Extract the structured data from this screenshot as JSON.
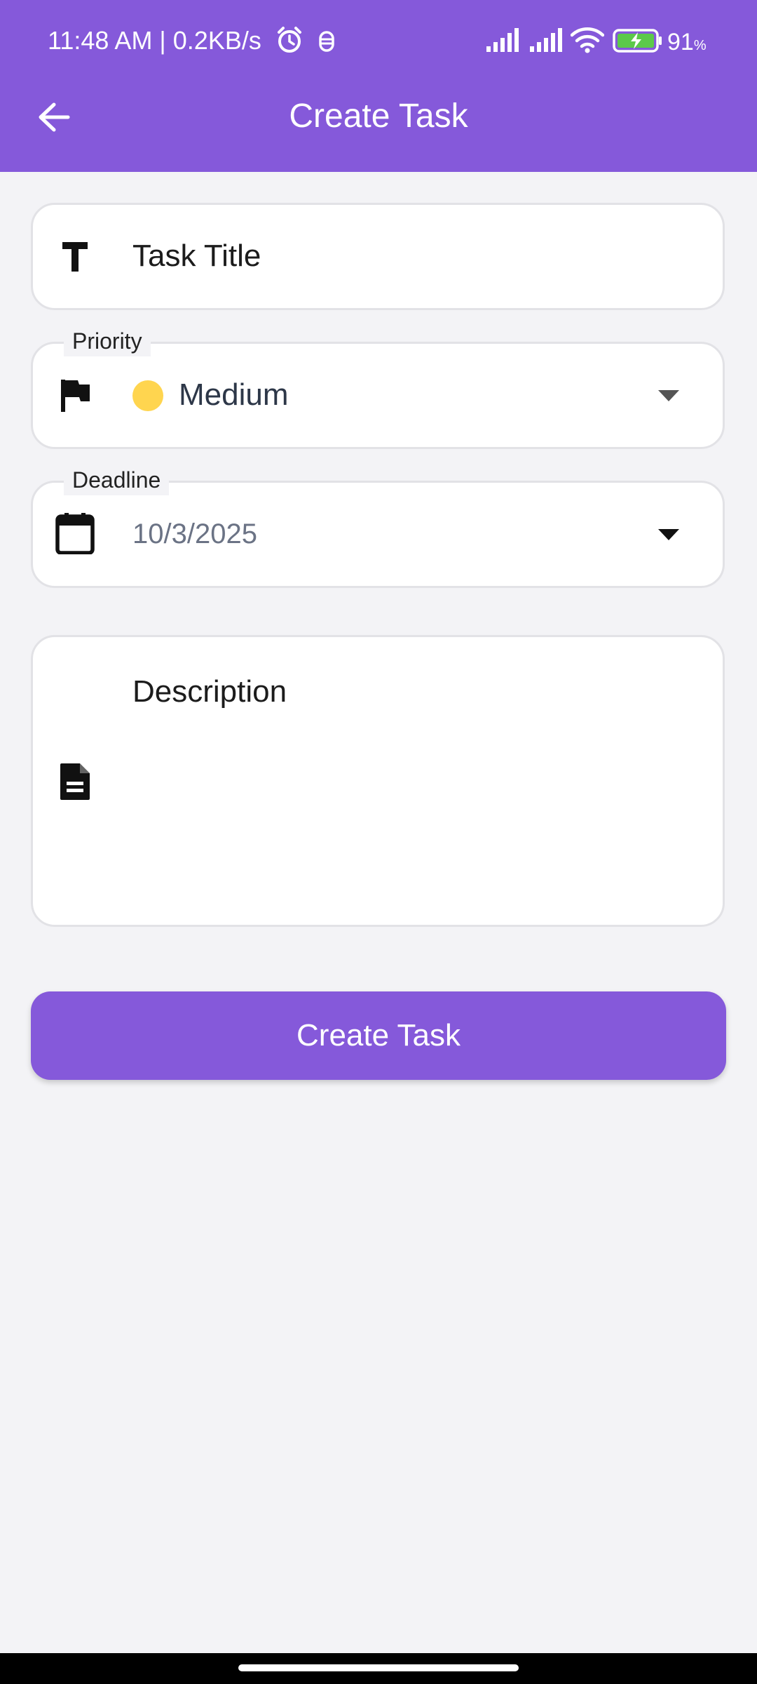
{
  "status_bar": {
    "time": "11:48 AM | 0.2KB/s",
    "battery": "91",
    "battery_unit": "%",
    "icons": [
      "alarm-icon",
      "notification-icon",
      "signal-icon",
      "signal-icon",
      "wifi-icon",
      "battery-charging-icon"
    ]
  },
  "header": {
    "title": "Create Task",
    "back_icon": "arrow-left-icon"
  },
  "form": {
    "title_field": {
      "placeholder": "Task Title",
      "icon": "text-title-icon"
    },
    "priority": {
      "label": "Priority",
      "value": "Medium",
      "dot_color": "#ffd54f",
      "icon": "flag-icon"
    },
    "deadline": {
      "label": "Deadline",
      "value": "10/3/2025",
      "icon": "calendar-icon"
    },
    "description": {
      "placeholder": "Description",
      "icon": "document-icon"
    }
  },
  "actions": {
    "submit_label": "Create Task"
  },
  "colors": {
    "primary": "#8559da",
    "background": "#f3f3f6",
    "border": "#e2e2e6"
  }
}
